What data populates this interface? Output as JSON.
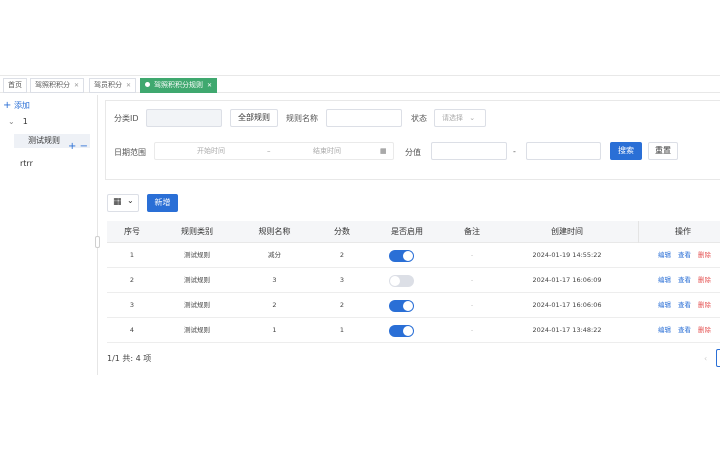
{
  "tabs": [
    {
      "label": "首页",
      "closable": false
    },
    {
      "label": "驾照积积分",
      "closable": true
    },
    {
      "label": "驾员积分",
      "closable": true
    },
    {
      "label": "驾照积积分规则",
      "closable": true,
      "active": true
    }
  ],
  "tree": {
    "add_label": "添加",
    "root_label": "1",
    "selected_item": "测试规则",
    "item2": "rtrr"
  },
  "filters": {
    "category_id_label": "分类ID",
    "all_rules_button": "全部规则",
    "rule_name_label": "规则名称",
    "status_label": "状态",
    "status_placeholder": "请选择",
    "date_range_label": "日期范围",
    "start_placeholder": "开始时间",
    "range_sep": "–",
    "end_placeholder": "结束时间",
    "score_label": "分值",
    "score_sep": "-",
    "search_button": "搜索",
    "reset_button": "重置"
  },
  "toolbar": {
    "new_button": "新增"
  },
  "table": {
    "headers": [
      "序号",
      "规则类别",
      "规则名称",
      "分数",
      "是否启用",
      "备注",
      "创建时间",
      "操作"
    ],
    "rows": [
      {
        "index": "1",
        "category": "测试规则",
        "name": "减分",
        "score": "2",
        "enabled": true,
        "remark": "-",
        "created": "2024-01-19 14:55:22"
      },
      {
        "index": "2",
        "category": "测试规则",
        "name": "3",
        "score": "3",
        "enabled": false,
        "remark": "-",
        "created": "2024-01-17 16:06:09"
      },
      {
        "index": "3",
        "category": "测试规则",
        "name": "2",
        "score": "2",
        "enabled": true,
        "remark": "-",
        "created": "2024-01-17 16:06:06"
      },
      {
        "index": "4",
        "category": "测试规则",
        "name": "1",
        "score": "1",
        "enabled": true,
        "remark": "-",
        "created": "2024-01-17 13:48:22"
      }
    ],
    "ops": {
      "edit": "编辑",
      "view": "查看",
      "delete": "删除"
    }
  },
  "footer": {
    "page_info": "1/1 共: 4 项",
    "prev_glyph": "‹"
  },
  "colors": {
    "primary": "#2a6fd6",
    "active_tab": "#3fa86f",
    "danger": "#e55353"
  }
}
